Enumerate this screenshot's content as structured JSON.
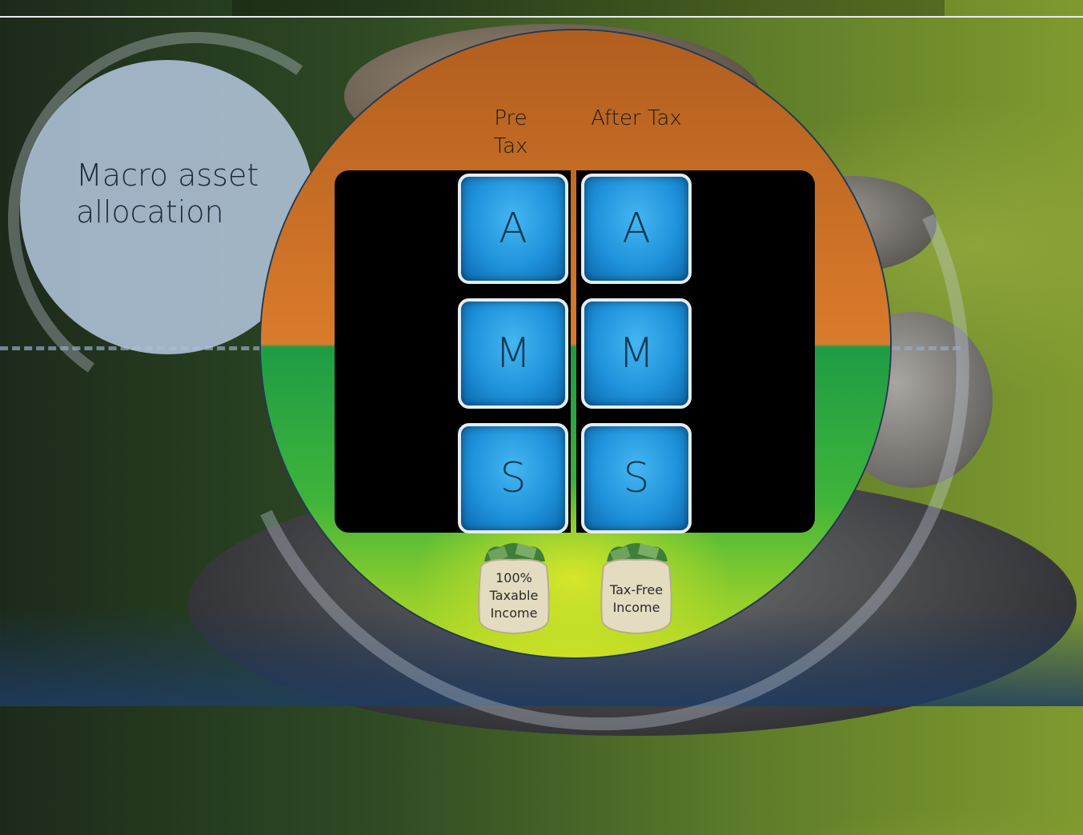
{
  "slide": {
    "title": "Macro asset allocation",
    "columns": {
      "pre_tax": "Pre Tax",
      "after_tax": "After Tax"
    },
    "pre_tax_tiles": [
      "A",
      "M",
      "S"
    ],
    "after_tax_tiles": [
      "A",
      "M",
      "S"
    ],
    "bags": {
      "left_label": "100% Taxable Income",
      "right_label": "Tax-Free Income"
    },
    "colors": {
      "top_half": "#d97b2b",
      "bottom_half": "#3fb43a",
      "tile_blue": "#1f93dc"
    }
  }
}
